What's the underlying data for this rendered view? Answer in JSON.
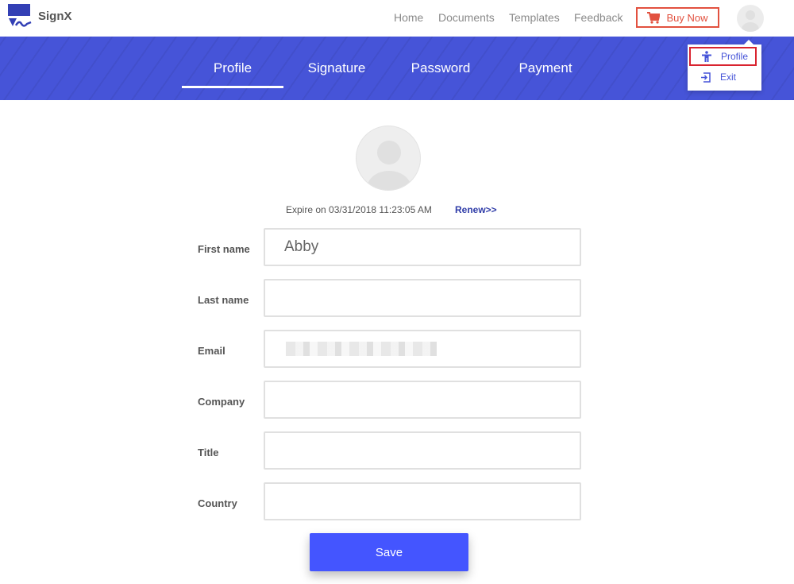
{
  "app": {
    "brand": "SignX"
  },
  "nav": {
    "items": [
      "Home",
      "Documents",
      "Templates",
      "Feedback"
    ],
    "buy_now": "Buy Now"
  },
  "tabs": [
    {
      "label": "Profile",
      "active": true
    },
    {
      "label": "Signature",
      "active": false
    },
    {
      "label": "Password",
      "active": false
    },
    {
      "label": "Payment",
      "active": false
    }
  ],
  "user_menu": {
    "items": [
      {
        "label": "Profile",
        "icon": "accessibility-person-icon",
        "active": true
      },
      {
        "label": "Exit",
        "icon": "exit-icon",
        "active": false
      }
    ]
  },
  "profile": {
    "expire_text": "Expire on 03/31/2018 11:23:05 AM",
    "renew_label": "Renew>>",
    "fields": [
      {
        "label": "First name",
        "value": "Abby"
      },
      {
        "label": "Last name",
        "value": ""
      },
      {
        "label": "Email",
        "value": ""
      },
      {
        "label": "Company",
        "value": ""
      },
      {
        "label": "Title",
        "value": ""
      },
      {
        "label": "Country",
        "value": ""
      }
    ],
    "save_label": "Save"
  },
  "colors": {
    "primary": "#4654d8",
    "button": "#4455ff",
    "buy_now": "#e2513f",
    "highlight": "#d9232f"
  }
}
